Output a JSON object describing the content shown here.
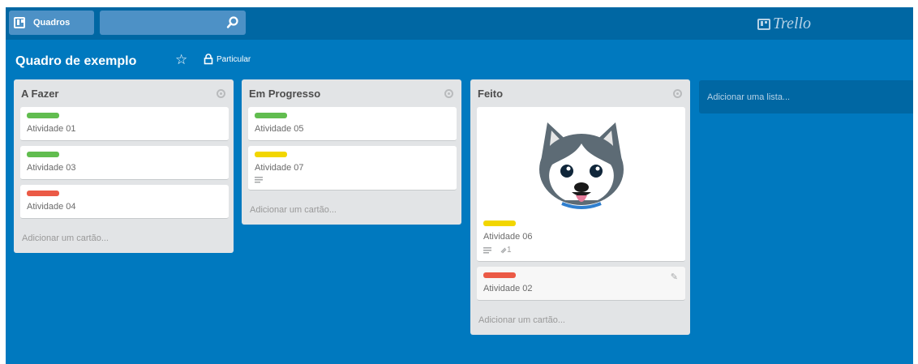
{
  "header": {
    "boards_label": "Quadros",
    "search_value": "",
    "logo_text": "Trello"
  },
  "board": {
    "title": "Quadro de exemplo",
    "visibility": "Particular"
  },
  "lists": [
    {
      "title": "A Fazer",
      "cards": [
        {
          "title": "Atividade 01",
          "label_color": "#61bd4f"
        },
        {
          "title": "Atividade 03",
          "label_color": "#61bd4f"
        },
        {
          "title": "Atividade 04",
          "label_color": "#eb5a46"
        }
      ],
      "add_card": "Adicionar um cartão..."
    },
    {
      "title": "Em Progresso",
      "cards": [
        {
          "title": "Atividade 05",
          "label_color": "#61bd4f"
        },
        {
          "title": "Atividade 07",
          "label_color": "#f2d600",
          "has_description": true
        }
      ],
      "add_card": "Adicionar um cartão..."
    },
    {
      "title": "Feito",
      "cards": [
        {
          "title": "Atividade 06",
          "label_color": "#f2d600",
          "has_description": true,
          "attachments": "1",
          "cover": "husky-image"
        },
        {
          "title": "Atividade 02",
          "label_color": "#eb5a46"
        }
      ],
      "add_card": "Adicionar um cartão..."
    }
  ],
  "add_list": "Adicionar uma lista...",
  "colors": {
    "board_bg": "#0079bf",
    "header_bg": "#0067a3",
    "list_bg": "#e2e4e6",
    "green": "#61bd4f",
    "yellow": "#f2d600",
    "red": "#eb5a46"
  }
}
